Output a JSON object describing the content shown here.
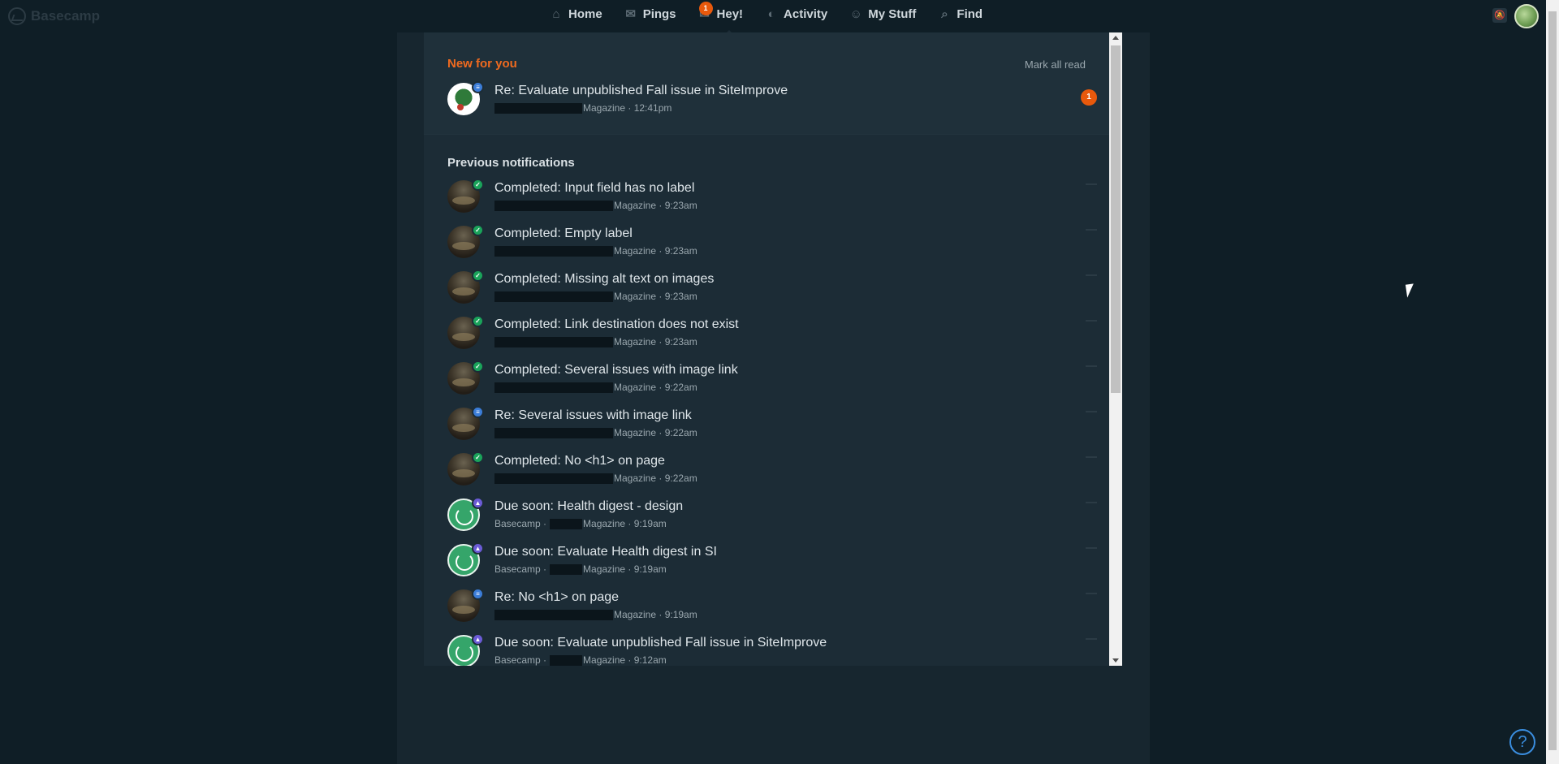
{
  "brand": {
    "name": "Basecamp"
  },
  "nav": {
    "items": [
      {
        "label": "Home",
        "icon": "home-icon"
      },
      {
        "label": "Pings",
        "icon": "pings-icon"
      },
      {
        "label": "Hey!",
        "icon": "hey-icon",
        "badge": "1"
      },
      {
        "label": "Activity",
        "icon": "activity-icon"
      },
      {
        "label": "My Stuff",
        "icon": "my-stuff-icon"
      },
      {
        "label": "Find",
        "icon": "search-icon"
      }
    ]
  },
  "hey": {
    "new_title": "New for you",
    "mark_all_read": "Mark all read",
    "new_items": [
      {
        "title": "Re: Evaluate unpublished Fall issue in SiteImprove",
        "meta_suffix": "Magazine · 12:41pm",
        "count": "1",
        "badge": "comment",
        "avatar": "green"
      }
    ],
    "previous_title": "Previous notifications",
    "previous_items": [
      {
        "title": "Completed: Input field has no label",
        "meta_prefix": "",
        "meta_suffix": "Magazine · 9:23am",
        "badge": "check",
        "avatar": "photo"
      },
      {
        "title": "Completed: Empty label",
        "meta_prefix": "",
        "meta_suffix": "Magazine · 9:23am",
        "badge": "check",
        "avatar": "photo"
      },
      {
        "title": "Completed: Missing alt text on images",
        "meta_prefix": "",
        "meta_suffix": "Magazine · 9:23am",
        "badge": "check",
        "avatar": "photo"
      },
      {
        "title": "Completed: Link destination does not exist",
        "meta_prefix": "",
        "meta_suffix": "Magazine · 9:23am",
        "badge": "check",
        "avatar": "photo"
      },
      {
        "title": "Completed: Several issues with image link",
        "meta_prefix": "",
        "meta_suffix": "Magazine · 9:22am",
        "badge": "check",
        "avatar": "photo"
      },
      {
        "title": "Re: Several issues with image link",
        "meta_prefix": "",
        "meta_suffix": "Magazine · 9:22am",
        "badge": "comment",
        "avatar": "photo"
      },
      {
        "title": "Completed: No <h1> on page",
        "meta_prefix": "",
        "meta_suffix": "Magazine · 9:22am",
        "badge": "check",
        "avatar": "photo"
      },
      {
        "title": "Due soon: Health digest - design",
        "meta_prefix": "Basecamp ·",
        "meta_suffix": "Magazine · 9:19am",
        "badge": "due",
        "avatar": "basecamp"
      },
      {
        "title": "Due soon: Evaluate Health digest in SI",
        "meta_prefix": "Basecamp ·",
        "meta_suffix": "Magazine · 9:19am",
        "badge": "due",
        "avatar": "basecamp"
      },
      {
        "title": "Re: No <h1> on page",
        "meta_prefix": "",
        "meta_suffix": "Magazine · 9:19am",
        "badge": "comment",
        "avatar": "photo"
      },
      {
        "title": "Due soon: Evaluate unpublished Fall issue in SiteImprove",
        "meta_prefix": "Basecamp ·",
        "meta_suffix": "Magazine · 9:12am",
        "badge": "due",
        "avatar": "basecamp"
      }
    ]
  },
  "help": {
    "label": "?"
  },
  "colors": {
    "accent": "#f06a1f",
    "background": "#0f1e26",
    "panel": "#1c2c36",
    "check": "#1aa35a",
    "comment": "#3b7dd8",
    "due": "#6b5bd6"
  }
}
